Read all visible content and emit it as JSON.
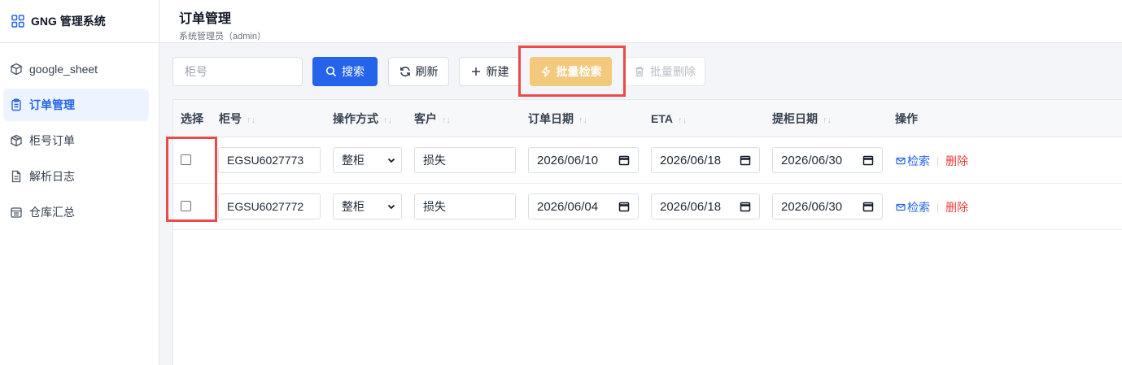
{
  "app": {
    "brand_title": "GNG 管理系统"
  },
  "sidebar": {
    "items": [
      {
        "label": "google_sheet",
        "icon": "cube-icon",
        "active": false
      },
      {
        "label": "订单管理",
        "icon": "clipboard-icon",
        "active": true
      },
      {
        "label": "柜号订单",
        "icon": "package-icon",
        "active": false
      },
      {
        "label": "解析日志",
        "icon": "file-text-icon",
        "active": false
      },
      {
        "label": "仓库汇总",
        "icon": "warehouse-icon",
        "active": false
      }
    ]
  },
  "header": {
    "title": "订单管理",
    "subtitle": "系统管理员（admin）"
  },
  "toolbar": {
    "search_placeholder": "柜号",
    "search_label": "搜索",
    "refresh_label": "刷新",
    "new_label": "新建",
    "batch_search_label": "批量检索",
    "batch_delete_label": "批量删除"
  },
  "table": {
    "columns": {
      "select": "选择",
      "container": "柜号",
      "method": "操作方式",
      "customer": "客户",
      "order_date": "订单日期",
      "eta": "ETA",
      "pickup_date": "提柜日期",
      "actions": "操作"
    },
    "sort_glyph": "↑↓",
    "rows": [
      {
        "container": "EGSU6027773",
        "method": "整柜",
        "customer": "损失",
        "order_date": "2026/06/10",
        "eta": "2026/06/18",
        "pickup_date": "2026/06/30",
        "detail_label": "检索",
        "sep": "|",
        "delete_label": "删除"
      },
      {
        "container": "EGSU6027772",
        "method": "整柜",
        "customer": "损失",
        "order_date": "2026/06/04",
        "eta": "2026/06/18",
        "pickup_date": "2026/06/30",
        "detail_label": "检索",
        "sep": "|",
        "delete_label": "删除"
      }
    ]
  },
  "colors": {
    "primary": "#2563eb",
    "batch_button": "#f3c97e",
    "danger": "#e53e3e",
    "highlight_box": "#ea4a4a"
  }
}
